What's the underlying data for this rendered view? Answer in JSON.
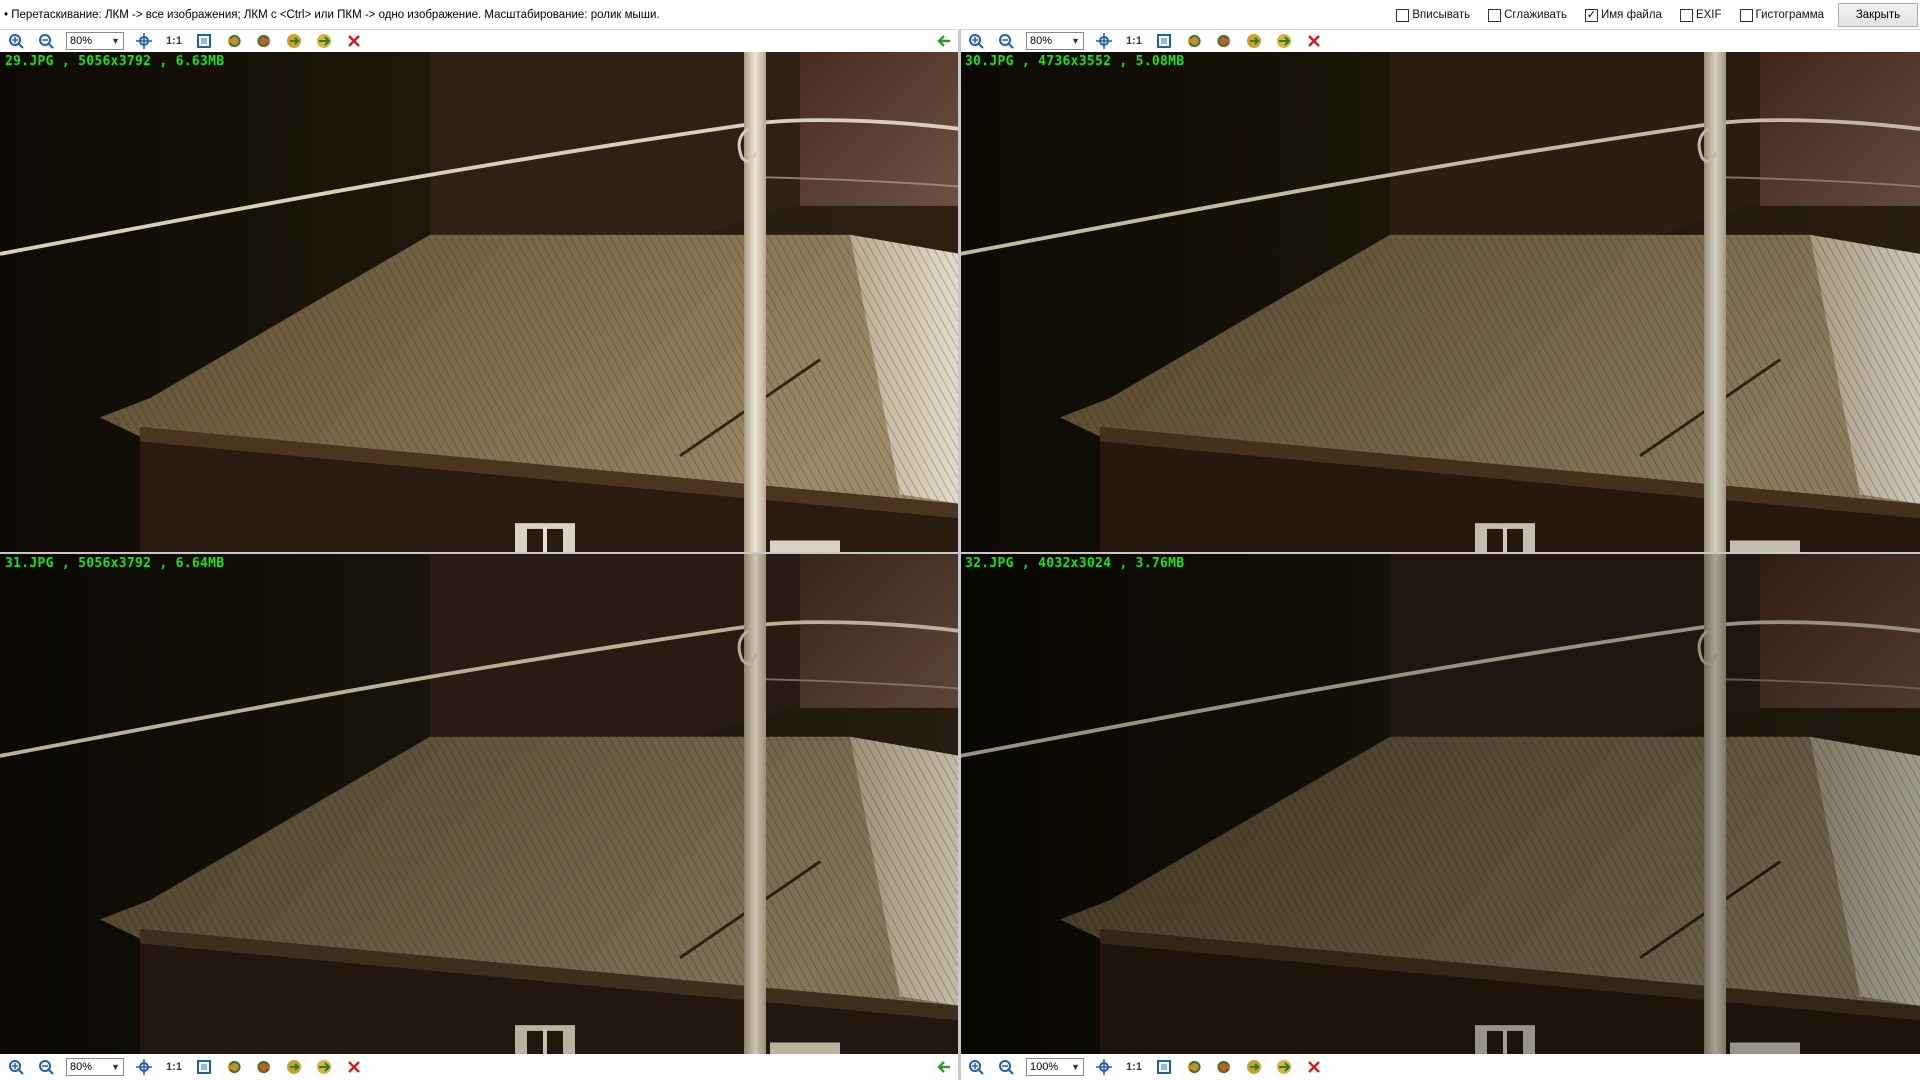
{
  "topbar": {
    "hint": "• Перетаскивание: ЛКМ -> все изображения; ЛКМ с <Ctrl> или ПКМ -> одно изображение. Масштабирование: ролик мыши.",
    "options": [
      {
        "label": "Вписывать",
        "checked": false
      },
      {
        "label": "Сглаживать",
        "checked": false
      },
      {
        "label": "Имя файла",
        "checked": true
      },
      {
        "label": "EXIF",
        "checked": false
      },
      {
        "label": "Гистограмма",
        "checked": false
      }
    ],
    "close_label": "Закрыть"
  },
  "panels": [
    {
      "caption": "29.JPG , 5056x3792 , 6.63MB",
      "zoom": "80%"
    },
    {
      "caption": "30.JPG , 4736x3552 , 5.08MB",
      "zoom": "80%"
    },
    {
      "caption": "31.JPG , 5056x3792 , 6.64MB",
      "zoom": "80%"
    },
    {
      "caption": "32.JPG , 4032x3024 , 3.76MB",
      "zoom": "100%"
    }
  ],
  "toolbar": {
    "one_to_one_label": "1:1",
    "icons": [
      "zoom-in-icon",
      "zoom-out-icon",
      "fit-icon",
      "actual-size-icon",
      "frame-icon",
      "rotate-left-icon",
      "rotate-right-icon",
      "sync-icon",
      "next-icon",
      "close-icon",
      "arrow-left-icon"
    ]
  },
  "colors": {
    "caption": "#16e516",
    "close_x": "#d21b1b",
    "arrow": "#2e9a2e",
    "zoom_icon": "#1f5fa8"
  }
}
